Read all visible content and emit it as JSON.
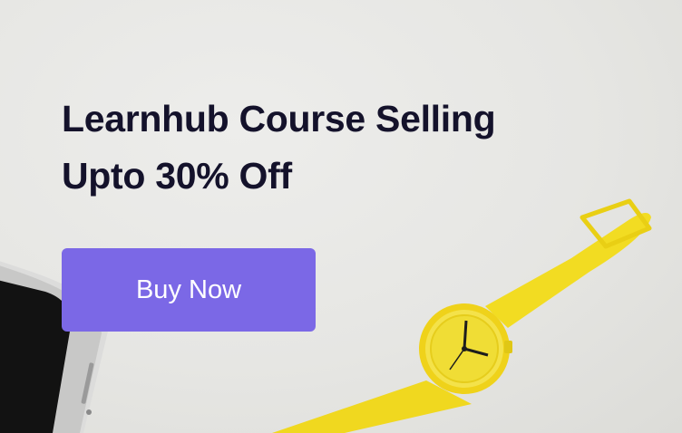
{
  "banner": {
    "headline_line1": "Learnhub Course Selling",
    "headline_line2": "Upto 30% Off",
    "button_label": "Buy Now"
  },
  "colors": {
    "headline": "#14122b",
    "button": "#7b68e6",
    "button_text": "#ffffff",
    "watch": "#f2dc22",
    "background": "#e6e6e3"
  },
  "icons": [
    "smartphone-image",
    "wristwatch-image"
  ]
}
